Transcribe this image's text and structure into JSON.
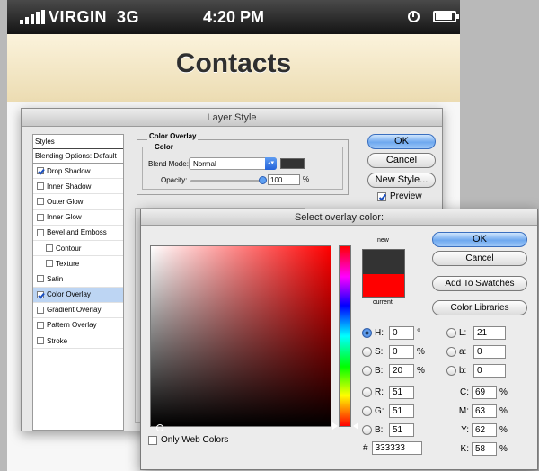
{
  "statusbar": {
    "carrier": "VIRGIN",
    "network": "3G",
    "time": "4:20 PM"
  },
  "navbar": {
    "title": "Contacts",
    "accent": "#ecdcb2"
  },
  "layer_style": {
    "title": "Layer Style",
    "styles_header": "Styles",
    "blending_options": "Blending Options: Default",
    "items": [
      {
        "label": "Drop Shadow",
        "checked": true
      },
      {
        "label": "Inner Shadow",
        "checked": false
      },
      {
        "label": "Outer Glow",
        "checked": false
      },
      {
        "label": "Inner Glow",
        "checked": false
      },
      {
        "label": "Bevel and Emboss",
        "checked": false
      },
      {
        "label": "Contour",
        "checked": false
      },
      {
        "label": "Texture",
        "checked": false
      },
      {
        "label": "Satin",
        "checked": false
      },
      {
        "label": "Color Overlay",
        "checked": true
      },
      {
        "label": "Gradient Overlay",
        "checked": false
      },
      {
        "label": "Pattern Overlay",
        "checked": false
      },
      {
        "label": "Stroke",
        "checked": false
      }
    ],
    "section_title": "Color Overlay",
    "section_sub": "Color",
    "blend_mode_label": "Blend Mode:",
    "blend_mode_value": "Normal",
    "opacity_label": "Opacity:",
    "opacity_value": "100",
    "opacity_unit": "%",
    "overlay_color": "#333333",
    "buttons": {
      "ok": "OK",
      "cancel": "Cancel",
      "new_style": "New Style...",
      "preview": "Preview"
    },
    "preview_checked": true
  },
  "picker": {
    "title": "Select overlay color:",
    "new_label": "new",
    "current_label": "current",
    "new_color": "#333333",
    "current_color": "#ff0000",
    "buttons": {
      "ok": "OK",
      "cancel": "Cancel",
      "add_swatches": "Add To Swatches",
      "libraries": "Color Libraries"
    },
    "hsb": {
      "h": "0",
      "h_unit": "°",
      "s": "0",
      "s_unit": "%",
      "b": "20",
      "b_unit": "%"
    },
    "rgb": {
      "r": "51",
      "g": "51",
      "b": "51"
    },
    "lab": {
      "l": "21",
      "a": "0",
      "b": "0"
    },
    "cmyk": {
      "c": "69",
      "m": "63",
      "y": "62",
      "k": "58",
      "unit": "%"
    },
    "labels": {
      "h": "H:",
      "s": "S:",
      "b": "B:",
      "r": "R:",
      "g": "G:",
      "rgb_b": "B:",
      "l": "L:",
      "a": "a:",
      "lab_b": "b:",
      "c": "C:",
      "m": "M:",
      "y": "Y:",
      "k": "K:",
      "hash": "#"
    },
    "hex": "333333",
    "only_web_colors": "Only Web Colors",
    "selected_channel": "H"
  }
}
